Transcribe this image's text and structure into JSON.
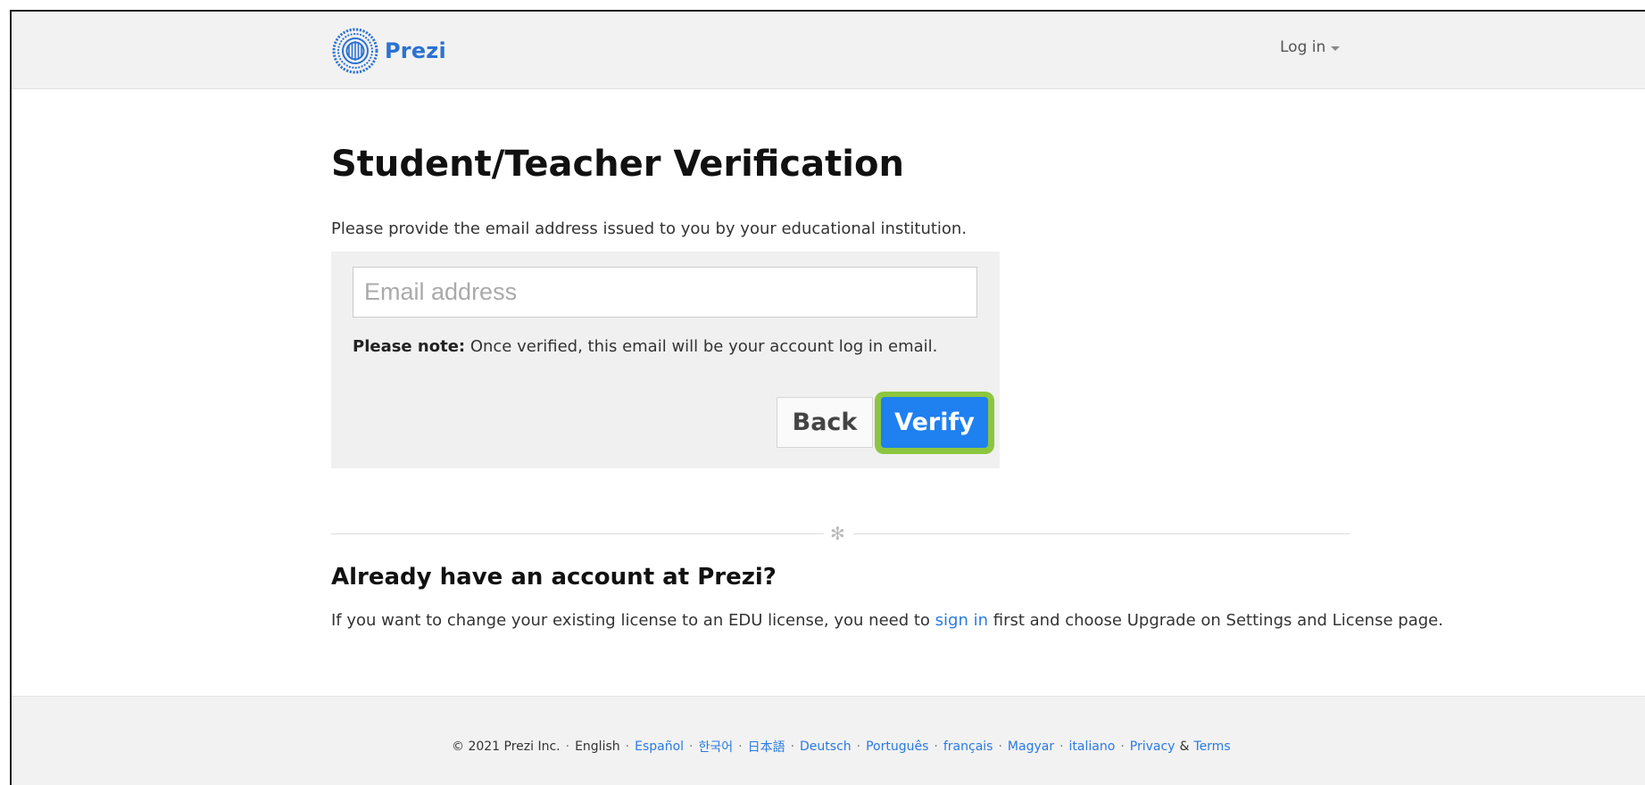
{
  "header": {
    "logo_text": "Prezi",
    "login_label": "Log in"
  },
  "main": {
    "title": "Student/Teacher Verification",
    "intro": "Please provide the email address issued to you by your educational institution.",
    "email_placeholder": "Email address",
    "email_value": "",
    "note_bold": "Please note:",
    "note_text": " Once verified, this email will be your account log in email.",
    "back_label": "Back",
    "verify_label": "Verify",
    "divider_icon": "✻"
  },
  "account": {
    "title": "Already have an account at Prezi?",
    "text_before": "If you want to change your existing license to an EDU license, you need to ",
    "signin_link": "sign in",
    "text_after": " first and choose Upgrade on Settings and License page."
  },
  "footer": {
    "copyright": "© 2021 Prezi Inc.",
    "current_language": "English",
    "languages": [
      "Español",
      "한국어",
      "日本語",
      "Deutsch",
      "Português",
      "français",
      "Magyar",
      "italiano"
    ],
    "privacy": "Privacy",
    "amp": "&",
    "terms": "Terms"
  },
  "colors": {
    "brand_blue": "#2c72d2",
    "verify_button": "#1f80f0",
    "focus_ring": "#8cc63f",
    "link": "#2a7ae2"
  },
  "icons": {
    "logo": "prezi-sunburst-logo",
    "login_dropdown": "caret-down",
    "divider": "asterisk-ornament"
  }
}
